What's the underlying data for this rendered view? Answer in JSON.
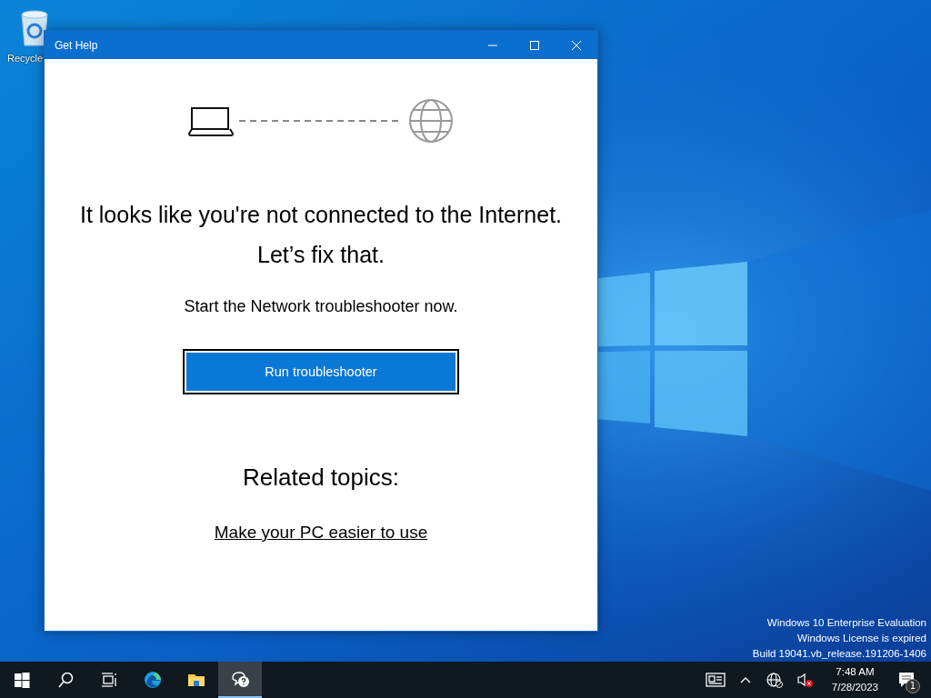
{
  "desktop": {
    "icons": [
      {
        "label": "Recycle"
      }
    ],
    "watermark": [
      "Windows 10 Enterprise Evaluation",
      "Windows License is expired",
      "Build 19041.vb_release.191206-1406"
    ]
  },
  "window": {
    "title": "Get Help",
    "heading": "It looks like you're not connected to the Internet.",
    "subheading": "Let’s fix that.",
    "instruction": "Start the Network troubleshooter now.",
    "button": "Run troubleshooter",
    "related_title": "Related topics:",
    "related_links": [
      "Make your PC easier to use"
    ]
  },
  "taskbar": {
    "apps": [
      {
        "kind": "start",
        "selected": false
      },
      {
        "kind": "search",
        "selected": false
      },
      {
        "kind": "taskview",
        "selected": false
      },
      {
        "kind": "edge",
        "selected": false
      },
      {
        "kind": "explorer",
        "selected": false
      },
      {
        "kind": "help",
        "selected": true
      }
    ],
    "tray": [
      {
        "kind": "news"
      },
      {
        "kind": "chevron"
      },
      {
        "kind": "network"
      },
      {
        "kind": "volume",
        "muted": true
      }
    ],
    "clock": {
      "time": "7:48 AM",
      "date": "7/28/2023"
    },
    "notifications": {
      "count": "1"
    }
  }
}
